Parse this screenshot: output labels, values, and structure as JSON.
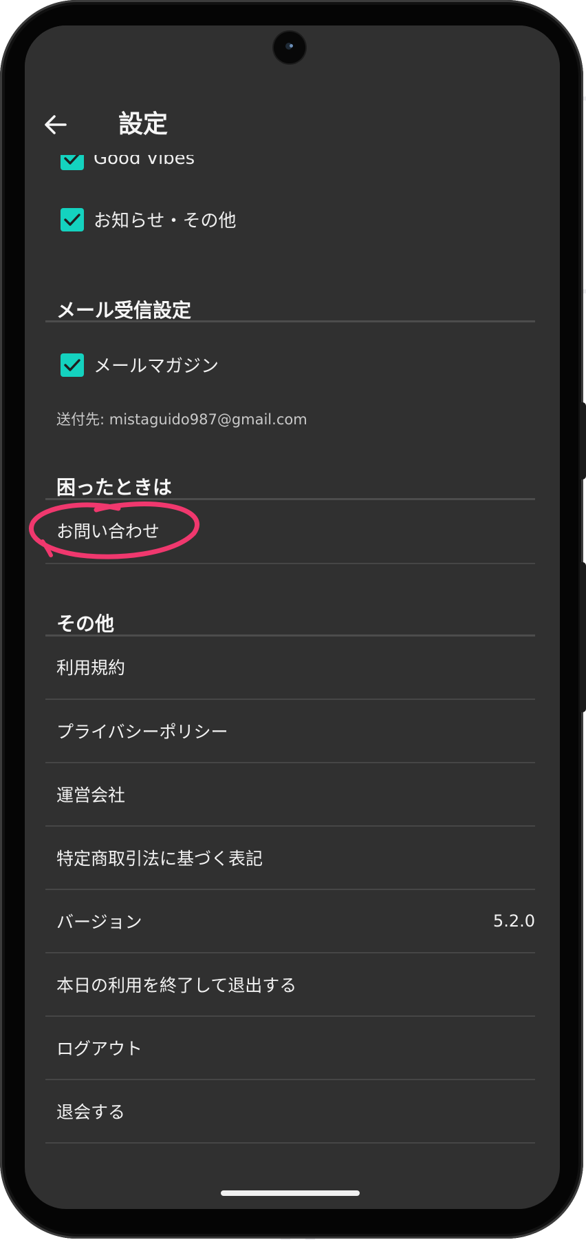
{
  "header": {
    "title": "設定"
  },
  "notifications": {
    "partial_item_label": "Good Vibes",
    "items": [
      {
        "label": "お知らせ・その他",
        "checked": true
      }
    ]
  },
  "mail_settings": {
    "header": "メール受信設定",
    "items": [
      {
        "label": "メールマガジン",
        "checked": true
      }
    ],
    "recipient_text": "送付先: mistaguido987@gmail.com"
  },
  "help": {
    "header": "困ったときは",
    "items": [
      {
        "label": "お問い合わせ"
      }
    ]
  },
  "other": {
    "header": "その他",
    "items": [
      {
        "label": "利用規約"
      },
      {
        "label": "プライバシーポリシー"
      },
      {
        "label": "運営会社"
      },
      {
        "label": "特定商取引法に基づく表記"
      },
      {
        "label": "バージョン",
        "value": "5.2.0"
      },
      {
        "label": "本日の利用を終了して退出する"
      },
      {
        "label": "ログアウト"
      },
      {
        "label": "退会する"
      }
    ]
  },
  "colors": {
    "background": "#303030",
    "checkbox_accent": "#14d2bf",
    "annotation_circle": "#f0386e",
    "divider": "#4c4c4c"
  },
  "icons": {
    "back": "arrow-left-icon",
    "checkbox": "check-icon"
  }
}
